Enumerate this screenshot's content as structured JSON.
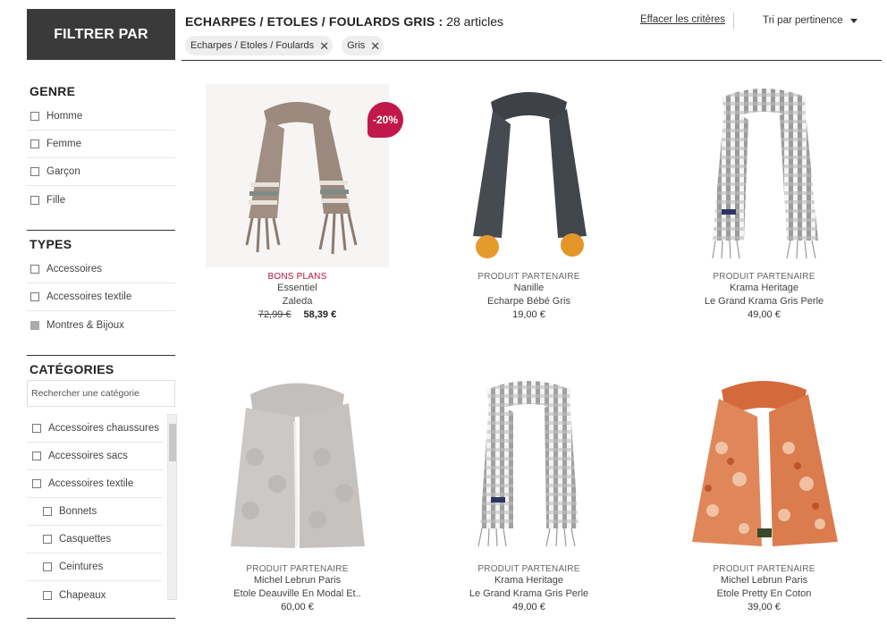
{
  "filter_button": "FILTRER PAR",
  "sidebar": {
    "genre": {
      "title": "GENRE",
      "options": [
        "Homme",
        "Femme",
        "Garçon",
        "Fille"
      ]
    },
    "types": {
      "title": "TYPES",
      "options": [
        "Accessoires",
        "Accessoires textile",
        "Montres & Bijoux"
      ]
    },
    "categories": {
      "title": "CATÉGORIES",
      "search_placeholder": "Rechercher une catégorie",
      "options": [
        "Accessoires chaussures",
        "Accessoires sacs",
        "Accessoires textile"
      ],
      "sub_options": [
        "Bonnets",
        "Casquettes",
        "Ceintures",
        "Chapeaux"
      ]
    }
  },
  "header": {
    "title": "ECHARPES / ETOLES / FOULARDS GRIS :",
    "count": "28 articles",
    "chips": [
      "Echarpes / Etoles / Foulards",
      "Gris"
    ],
    "chip_remove": "✕",
    "clear": "Effacer les critères",
    "sort": "Tri par pertinence"
  },
  "colors": {
    "accent": "#c1184a",
    "dark": "#3a3a3a"
  },
  "products": [
    {
      "tag": "BONS PLANS",
      "brand": "Essentiel",
      "name": "Zaleda",
      "old_price": "72,99 €",
      "price": "58,39 €",
      "badge": "-20%"
    },
    {
      "tag": "PRODUIT PARTENAIRE",
      "brand": "Nanille",
      "name": "Echarpe Bébé Gris",
      "price": "19,00 €"
    },
    {
      "tag": "PRODUIT PARTENAIRE",
      "brand": "Krama Heritage",
      "name": "Le Grand Krama Gris Perle",
      "price": "49,00 €"
    },
    {
      "tag": "PRODUIT PARTENAIRE",
      "brand": "Michel Lebrun Paris",
      "name": "Etole Deauville En Modal Et..",
      "price": "60,00 €"
    },
    {
      "tag": "PRODUIT PARTENAIRE",
      "brand": "Krama Heritage",
      "name": "Le Grand Krama Gris Perle",
      "price": "49,00 €"
    },
    {
      "tag": "PRODUIT PARTENAIRE",
      "brand": "Michel Lebrun Paris",
      "name": "Etole Pretty En Coton",
      "price": "39,00 €"
    }
  ]
}
